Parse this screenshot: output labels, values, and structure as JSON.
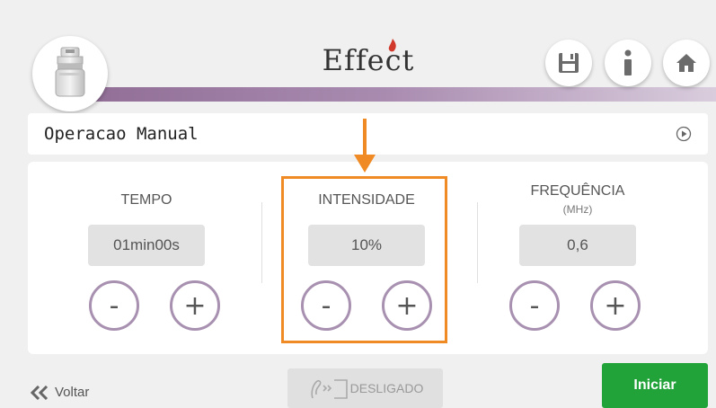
{
  "header": {
    "logo_text": "Effect",
    "brand_flame_color": "#d0392b",
    "accent_bar_color": "#8e6b93",
    "buttons": [
      {
        "icon": "save-icon"
      },
      {
        "icon": "info-icon"
      },
      {
        "icon": "home-icon"
      }
    ]
  },
  "mode": {
    "label": "Operacao Manual",
    "icon": "play-circle-icon"
  },
  "params": {
    "tempo": {
      "title": "TEMPO",
      "value": "01min00s",
      "minus": "-",
      "plus": "+"
    },
    "intensidade": {
      "title": "INTENSIDADE",
      "value": "10%",
      "minus": "-",
      "plus": "+"
    },
    "frequencia": {
      "title": "FREQUÊNCIA",
      "unit": "(MHz)",
      "value": "0,6",
      "minus": "-",
      "plus": "+"
    }
  },
  "highlight_color": "#f08a24",
  "footer": {
    "back_label": "Voltar",
    "status_label": "DESLIGADO",
    "start_label": "Iniciar",
    "start_color": "#22a33a"
  }
}
